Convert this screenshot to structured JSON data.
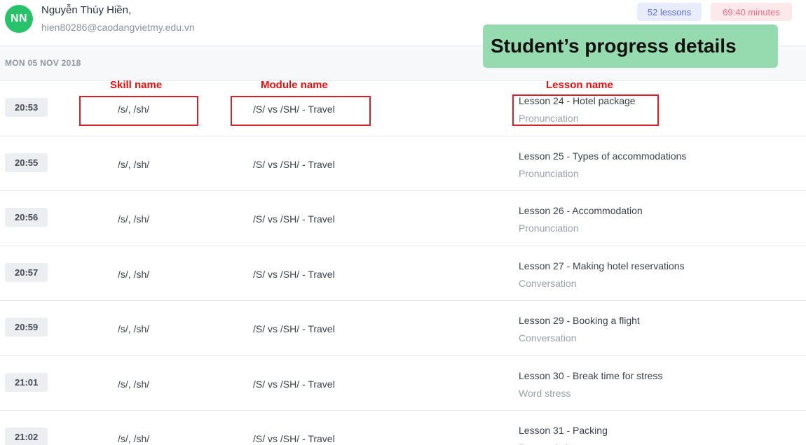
{
  "user": {
    "initials": "NN",
    "name": "Nguyễn Thúy Hiền,",
    "email": "hien80286@caodangvietmy.edu.vn",
    "avatar_color": "#27c26a"
  },
  "badges": {
    "lessons": "52 lessons",
    "minutes": "69:40 minutes"
  },
  "banner": "Student’s progress details",
  "date_label": "MON 05 NOV 2018",
  "annotations": {
    "skill": "Skill name",
    "module": "Module name",
    "lesson": "Lesson name",
    "color": "#e01010"
  },
  "rows": [
    {
      "time": "20:53",
      "skill": "/s/, /sh/",
      "module": "/S/ vs /SH/ - Travel",
      "lesson": "Lesson 24 - Hotel package",
      "type": "Pronunciation"
    },
    {
      "time": "20:55",
      "skill": "/s/, /sh/",
      "module": "/S/ vs /SH/ - Travel",
      "lesson": "Lesson 25 - Types of accommodations",
      "type": "Pronunciation"
    },
    {
      "time": "20:56",
      "skill": "/s/, /sh/",
      "module": "/S/ vs /SH/ - Travel",
      "lesson": "Lesson 26 - Accommodation",
      "type": "Pronunciation"
    },
    {
      "time": "20:57",
      "skill": "/s/, /sh/",
      "module": "/S/ vs /SH/ - Travel",
      "lesson": "Lesson 27 - Making hotel reservations",
      "type": "Conversation"
    },
    {
      "time": "20:59",
      "skill": "/s/, /sh/",
      "module": "/S/ vs /SH/ - Travel",
      "lesson": "Lesson 29 - Booking a flight",
      "type": "Conversation"
    },
    {
      "time": "21:01",
      "skill": "/s/, /sh/",
      "module": "/S/ vs /SH/ - Travel",
      "lesson": "Lesson 30 - Break time for stress",
      "type": "Word stress"
    },
    {
      "time": "21:02",
      "skill": "/s/, /sh/",
      "module": "/S/ vs /SH/ - Travel",
      "lesson": "Lesson 31 - Packing",
      "type": "Pronunciation"
    }
  ]
}
